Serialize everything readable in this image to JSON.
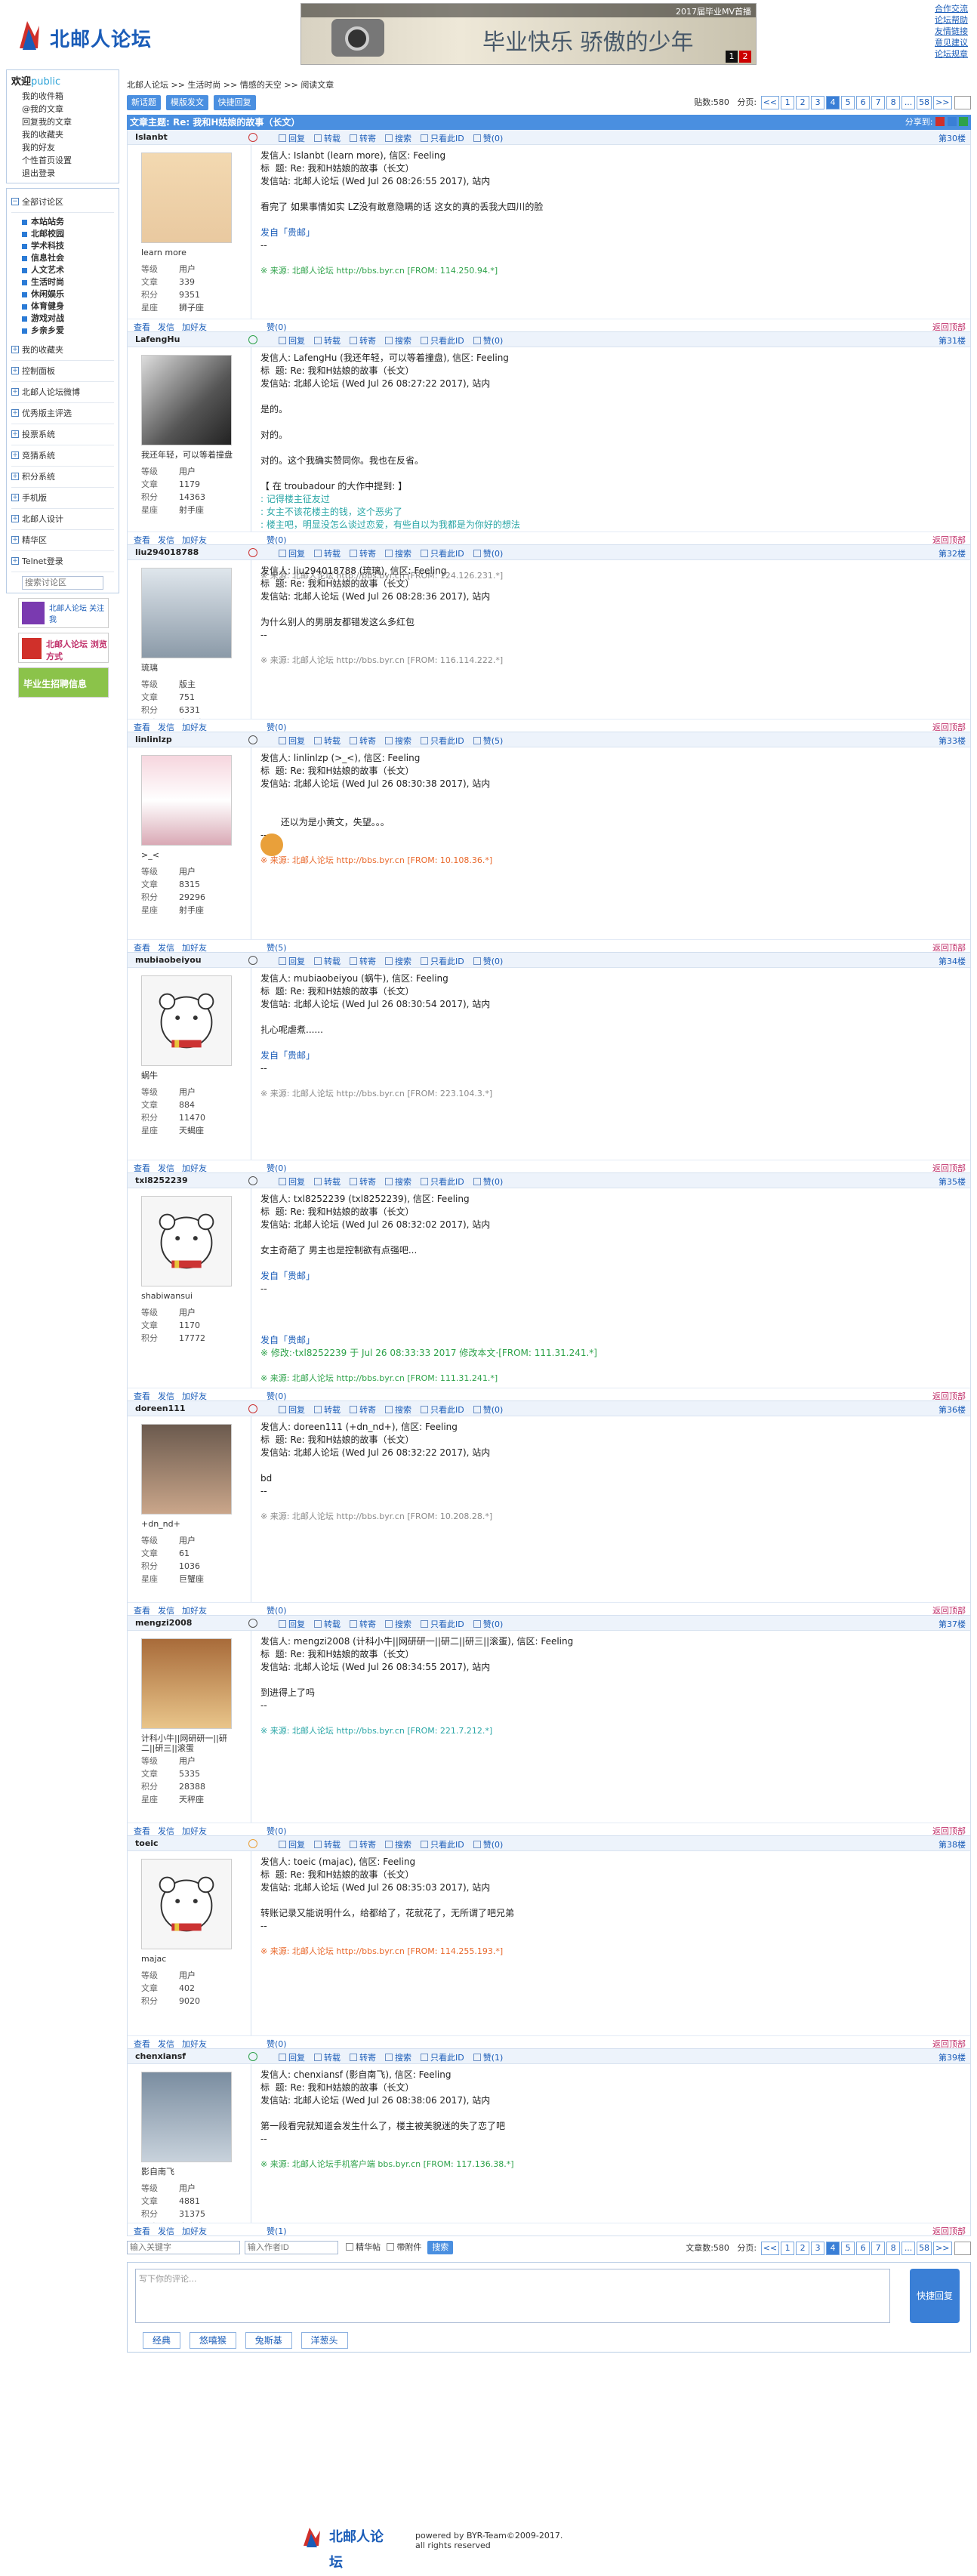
{
  "site": {
    "logo_text": "北邮人论坛",
    "banner_top": "2017届毕业MV首播",
    "banner_slogan": "毕业快乐 骄傲的少年",
    "banner_dots": [
      "1",
      "2"
    ],
    "top_links": [
      "合作交流",
      "论坛帮助",
      "友情链接",
      "意见建议",
      "论坛规章"
    ]
  },
  "sidebar": {
    "welcome": "欢迎",
    "user": "public",
    "user_links": [
      "我的收件箱",
      "@我的文章",
      "回复我的文章",
      "我的收藏夹",
      "我的好友",
      "个性首页设置",
      "退出登录"
    ],
    "all_boards": "全部讨论区",
    "boards": [
      "本站站务",
      "北邮校园",
      "学术科技",
      "信息社会",
      "人文艺术",
      "生活时尚",
      "休闲娱乐",
      "体育健身",
      "游戏对战",
      "乡亲乡爱"
    ],
    "items": [
      "我的收藏夹",
      "控制面板",
      "北邮人论坛微博",
      "优秀版主评选",
      "投票系统",
      "竞猜系统",
      "积分系统",
      "手机版",
      "北邮人设计",
      "精华区",
      "Telnet登录"
    ],
    "search_placeholder": "搜索讨论区",
    "ads": [
      "北邮人论坛 关注我",
      "北邮人论坛 浏览方式",
      "毕业生招聘信息"
    ]
  },
  "main": {
    "breadcrumb": [
      "北邮人论坛",
      "生活时尚",
      "情感的天空",
      "阅读文章"
    ],
    "buttons": [
      "新话题",
      "模版发文",
      "快捷回复"
    ],
    "post_count_label": "贴数:580",
    "page_label": "分页:",
    "pages": [
      "<<",
      "1",
      "2",
      "3",
      "4",
      "5",
      "6",
      "7",
      "8",
      "...",
      "58",
      ">>"
    ],
    "current_page": "4",
    "topic_title": "文章主题: Re: 我和H姑娘的故事（长文）",
    "share_label": "分享到:",
    "ops": [
      "回复",
      "转载",
      "转寄",
      "搜索",
      "只看此ID",
      "赞"
    ],
    "foot_ops": [
      "查看",
      "发信",
      "加好友"
    ],
    "back_top": "返回顶部",
    "info_keys": [
      "等级",
      "文章",
      "积分",
      "星座"
    ],
    "bottom_search_placeholder": "输入关键字",
    "bottom_author_placeholder": "输入作者ID",
    "bottom_checks": [
      "精华帖",
      "带附件"
    ],
    "bottom_search_btn": "搜索",
    "bottom_count": "文章数:580",
    "reply_placeholder": "写下你的评论...",
    "reply_btn": "快捷回复",
    "reply_tabs": [
      "经典",
      "悠嘻猴",
      "兔斯基",
      "洋葱头"
    ]
  },
  "posts": [
    {
      "id": "Islanbt",
      "floor": "第30楼",
      "nick": "learn more",
      "level": "用户",
      "articles": "339",
      "score": "9351",
      "star": "狮子座",
      "likes": "赞(0)",
      "lines": [
        {
          "t": "发信人: Islanbt (learn more), 信区: Feeling",
          "c": ""
        },
        {
          "t": "标  题: Re: 我和H姑娘的故事（长文）",
          "c": ""
        },
        {
          "t": "发信站: 北邮人论坛 (Wed Jul 26 08:26:55 2017), 站内",
          "c": ""
        },
        {
          "t": " ",
          "c": ""
        },
        {
          "t": "看完了 如果事情如实 LZ没有敢意隐瞒的话 这女的真的丢我大四川的脸",
          "c": ""
        },
        {
          "t": " ",
          "c": ""
        },
        {
          "t": "发自「贵邮」",
          "c": "blue"
        },
        {
          "t": "--",
          "c": ""
        }
      ],
      "source": "※ 来源: 北邮人论坛 http://bbs.byr.cn [FROM: 114.250.94.*]",
      "scolor": "gr"
    },
    {
      "id": "LafengHu",
      "floor": "第31楼",
      "nick": "我还年轻，可以等着撞盘",
      "level": "用户",
      "articles": "1179",
      "score": "14363",
      "star": "射手座",
      "likes": "赞(0)",
      "lines": [
        {
          "t": "发信人: LafengHu (我还年轻，可以等着撞盘), 信区: Feeling",
          "c": ""
        },
        {
          "t": "标  题: Re: 我和H姑娘的故事（长文）",
          "c": ""
        },
        {
          "t": "发信站: 北邮人论坛 (Wed Jul 26 08:27:22 2017), 站内",
          "c": ""
        },
        {
          "t": " ",
          "c": ""
        },
        {
          "t": "是的。",
          "c": ""
        },
        {
          "t": " ",
          "c": ""
        },
        {
          "t": "对的。",
          "c": ""
        },
        {
          "t": " ",
          "c": ""
        },
        {
          "t": "对的。这个我确实赞同你。我也在反省。",
          "c": ""
        },
        {
          "t": " ",
          "c": ""
        },
        {
          "t": "【 在 troubadour 的大作中提到: 】",
          "c": ""
        },
        {
          "t": ": 记得楼主征友过",
          "c": "tl"
        },
        {
          "t": ": 女主不该花楼主的钱，这个恶劣了",
          "c": "tl"
        },
        {
          "t": ": 楼主吧，明显没怎么谈过恋爱，有些自以为我都是为你好的想法",
          "c": "tl"
        },
        {
          "t": " ",
          "c": ""
        },
        {
          "t": "--",
          "c": ""
        }
      ],
      "source": "※ 来源: 北邮人论坛 http://bbs.byr.cn [FROM: 124.126.231.*]",
      "scolor": "gy"
    },
    {
      "id": "liu294018788",
      "floor": "第32楼",
      "nick": "琉璃",
      "level": "版主",
      "articles": "751",
      "score": "6331",
      "star": "水瓶座",
      "likes": "赞(0)",
      "lines": [
        {
          "t": "发信人: liu294018788 (琉璃), 信区: Feeling",
          "c": ""
        },
        {
          "t": "标  题: Re: 我和H姑娘的故事（长文）",
          "c": ""
        },
        {
          "t": "发信站: 北邮人论坛 (Wed Jul 26 08:28:36 2017), 站内",
          "c": ""
        },
        {
          "t": " ",
          "c": ""
        },
        {
          "t": "为什么别人的男朋友都错发这么多红包",
          "c": ""
        },
        {
          "t": "--",
          "c": ""
        }
      ],
      "source": "※ 来源: 北邮人论坛 http://bbs.byr.cn [FROM: 116.114.222.*]",
      "scolor": "gy"
    },
    {
      "id": "linlinlzp",
      "floor": "第33楼",
      "nick": ">_<",
      "level": "用户",
      "articles": "8315",
      "score": "29296",
      "star": "射手座",
      "likes": "赞(5)",
      "lines": [
        {
          "t": "发信人: linlinlzp (>_<), 信区: Feeling",
          "c": ""
        },
        {
          "t": "标  题: Re: 我和H姑娘的故事（长文）",
          "c": ""
        },
        {
          "t": "发信站: 北邮人论坛 (Wed Jul 26 08:30:38 2017), 站内",
          "c": ""
        },
        {
          "t": " ",
          "c": ""
        },
        {
          "t": " ",
          "c": ""
        },
        {
          "t": "       还以为是小黄文，失望。。。",
          "c": ""
        },
        {
          "t": "--",
          "c": ""
        }
      ],
      "source": "※ 来源: 北邮人论坛 http://bbs.byr.cn [FROM: 10.108.36.*]",
      "scolor": "or"
    },
    {
      "id": "mubiaobeiyou",
      "floor": "第34楼",
      "nick": "蜗牛",
      "level": "用户",
      "articles": "884",
      "score": "11470",
      "star": "天蝎座",
      "likes": "赞(0)",
      "lines": [
        {
          "t": "发信人: mubiaobeiyou (蜗牛), 信区: Feeling",
          "c": ""
        },
        {
          "t": "标  题: Re: 我和H姑娘的故事（长文）",
          "c": ""
        },
        {
          "t": "发信站: 北邮人论坛 (Wed Jul 26 08:30:54 2017), 站内",
          "c": ""
        },
        {
          "t": " ",
          "c": ""
        },
        {
          "t": "扎心呢虐煮......",
          "c": ""
        },
        {
          "t": " ",
          "c": ""
        },
        {
          "t": "发自「贵邮」",
          "c": "blue"
        },
        {
          "t": "--",
          "c": ""
        }
      ],
      "source": "※ 来源: 北邮人论坛 http://bbs.byr.cn [FROM: 223.104.3.*]",
      "scolor": "gy"
    },
    {
      "id": "txl8252239",
      "floor": "第35楼",
      "nick": "shabiwansui",
      "level": "用户",
      "articles": "1170",
      "score": "17772",
      "star": "",
      "likes": "赞(0)",
      "lines": [
        {
          "t": "发信人: txl8252239 (txl8252239), 信区: Feeling",
          "c": ""
        },
        {
          "t": "标  题: Re: 我和H姑娘的故事（长文）",
          "c": ""
        },
        {
          "t": "发信站: 北邮人论坛 (Wed Jul 26 08:32:02 2017), 站内",
          "c": ""
        },
        {
          "t": " ",
          "c": ""
        },
        {
          "t": "女主奇葩了 男主也是控制欲有点强吧...",
          "c": ""
        },
        {
          "t": " ",
          "c": ""
        },
        {
          "t": "发自「贵邮」",
          "c": "blue"
        },
        {
          "t": "--",
          "c": ""
        },
        {
          "t": " ",
          "c": ""
        },
        {
          "t": " ",
          "c": ""
        },
        {
          "t": " ",
          "c": ""
        },
        {
          "t": "发自「贵邮」",
          "c": "blue"
        },
        {
          "t": "※ 修改:·txl8252239 于 Jul 26 08:33:33 2017 修改本文·[FROM: 111.31.241.*]",
          "c": "gr"
        }
      ],
      "source": "※ 来源: 北邮人论坛 http://bbs.byr.cn [FROM: 111.31.241.*]",
      "scolor": "gr"
    },
    {
      "id": "doreen111",
      "floor": "第36楼",
      "nick": "+dn_nd+",
      "level": "用户",
      "articles": "61",
      "score": "1036",
      "star": "巨蟹座",
      "likes": "赞(0)",
      "lines": [
        {
          "t": "发信人: doreen111 (+dn_nd+), 信区: Feeling",
          "c": ""
        },
        {
          "t": "标  题: Re: 我和H姑娘的故事（长文）",
          "c": ""
        },
        {
          "t": "发信站: 北邮人论坛 (Wed Jul 26 08:32:22 2017), 站内",
          "c": ""
        },
        {
          "t": " ",
          "c": ""
        },
        {
          "t": "bd",
          "c": ""
        },
        {
          "t": "--",
          "c": ""
        }
      ],
      "source": "※ 来源: 北邮人论坛 http://bbs.byr.cn [FROM: 10.208.28.*]",
      "scolor": "gy"
    },
    {
      "id": "mengzi2008",
      "floor": "第37楼",
      "nick": "计科小牛||网研研一||研二||研三||滚蛋",
      "level": "用户",
      "articles": "5335",
      "score": "28388",
      "star": "天秤座",
      "likes": "赞(0)",
      "lines": [
        {
          "t": "发信人: mengzi2008 (计科小牛||网研研一||研二||研三||滚蛋), 信区: Feeling",
          "c": ""
        },
        {
          "t": "标  题: Re: 我和H姑娘的故事（长文）",
          "c": ""
        },
        {
          "t": "发信站: 北邮人论坛 (Wed Jul 26 08:34:55 2017), 站内",
          "c": ""
        },
        {
          "t": " ",
          "c": ""
        },
        {
          "t": "到进得上了吗",
          "c": ""
        },
        {
          "t": "--",
          "c": ""
        }
      ],
      "source": "※ 来源: 北邮人论坛 http://bbs.byr.cn [FROM: 221.7.212.*]",
      "scolor": "tl"
    },
    {
      "id": "toeic",
      "floor": "第38楼",
      "nick": "majac",
      "level": "用户",
      "articles": "402",
      "score": "9020",
      "star": "",
      "likes": "赞(0)",
      "lines": [
        {
          "t": "发信人: toeic (majac), 信区: Feeling",
          "c": ""
        },
        {
          "t": "标  题: Re: 我和H姑娘的故事（长文）",
          "c": ""
        },
        {
          "t": "发信站: 北邮人论坛 (Wed Jul 26 08:35:03 2017), 站内",
          "c": ""
        },
        {
          "t": " ",
          "c": ""
        },
        {
          "t": "转账记录又能说明什么，给都给了，花就花了，无所谓了吧兄弟",
          "c": ""
        },
        {
          "t": "--",
          "c": ""
        }
      ],
      "source": "※ 来源: 北邮人论坛 http://bbs.byr.cn [FROM: 114.255.193.*]",
      "scolor": "or"
    },
    {
      "id": "chenxiansf",
      "floor": "第39楼",
      "nick": "影自南飞",
      "level": "用户",
      "articles": "4881",
      "score": "31375",
      "star": "金牛座",
      "likes": "赞(1)",
      "lines": [
        {
          "t": "发信人: chenxiansf (影自南飞), 信区: Feeling",
          "c": ""
        },
        {
          "t": "标  题: Re: 我和H姑娘的故事（长文）",
          "c": ""
        },
        {
          "t": "发信站: 北邮人论坛 (Wed Jul 26 08:38:06 2017), 站内",
          "c": ""
        },
        {
          "t": " ",
          "c": ""
        },
        {
          "t": "第一段看完就知道会发生什么了，楼主被美貌迷的失了恋了吧",
          "c": ""
        },
        {
          "t": "--",
          "c": ""
        }
      ],
      "source": "※ 来源: 北邮人论坛手机客户端 bbs.byr.cn [FROM: 117.136.38.*]",
      "scolor": "gr"
    }
  ],
  "footer": {
    "logo_text": "北邮人论坛",
    "powered": "powered by BYR-Team©2009-2017.",
    "rights": "all rights reserved"
  }
}
